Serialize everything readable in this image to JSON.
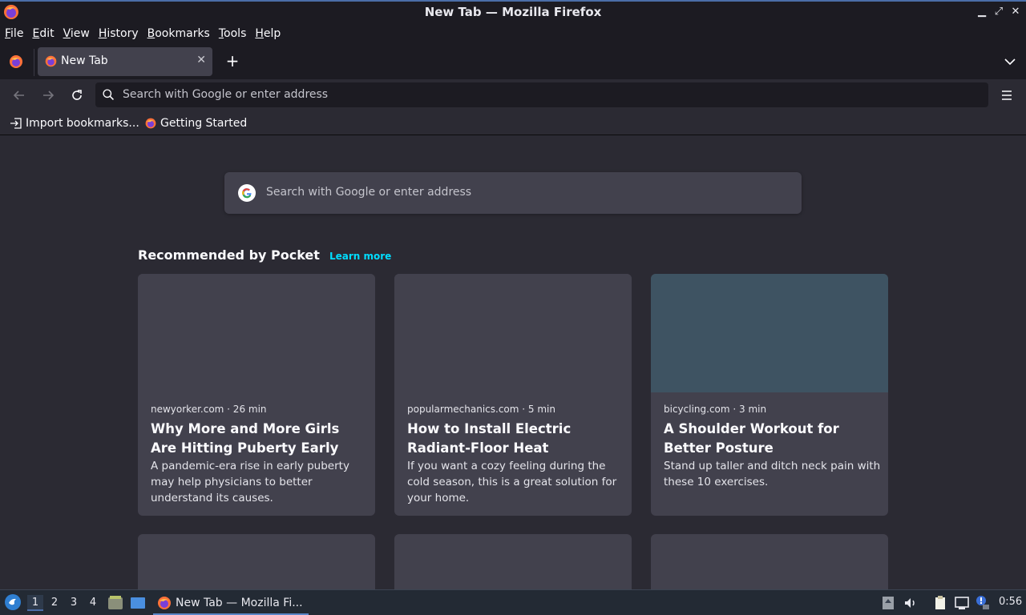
{
  "window": {
    "title": "New Tab — Mozilla Firefox",
    "minimize": "▁",
    "maximize": "⤢",
    "close": "✕"
  },
  "menubar": {
    "items": [
      "File",
      "Edit",
      "View",
      "History",
      "Bookmarks",
      "Tools",
      "Help"
    ]
  },
  "tabs": {
    "active_title": "New Tab",
    "close_glyph": "✕",
    "new_tab_glyph": "+"
  },
  "navbar": {
    "url_placeholder": "Search with Google or enter address"
  },
  "bookmarks": {
    "items": [
      {
        "label": "Import bookmarks...",
        "icon": "import-icon"
      },
      {
        "label": "Getting Started",
        "icon": "firefox-icon"
      }
    ]
  },
  "newtab": {
    "search_placeholder": "Search with Google or enter address",
    "pocket_title": "Recommended by Pocket",
    "learn_more": "Learn more",
    "cards": [
      {
        "meta": "newyorker.com · 26 min",
        "headline": "Why More and More Girls Are Hitting Puberty Early",
        "excerpt": "A pandemic-era rise in early puberty may help physicians to better understand its causes.",
        "thumb_color": "#42414d"
      },
      {
        "meta": "popularmechanics.com · 5 min",
        "headline": "How to Install Electric Radiant-Floor Heat",
        "excerpt": "If you want a cozy feeling during the cold season, this is a great solution for your home.",
        "thumb_color": "#42414d"
      },
      {
        "meta": "bicycling.com · 3 min",
        "headline": "A Shoulder Workout for Better Posture",
        "excerpt": "Stand up taller and ditch neck pain with these 10 exercises.",
        "thumb_color": "#3e5362"
      }
    ]
  },
  "taskbar": {
    "workspaces": [
      "1",
      "2",
      "3",
      "4"
    ],
    "task_label": "New Tab — Mozilla Fi...",
    "clock": "0:56"
  },
  "colors": {
    "accent": "#00ddff",
    "chrome_bg": "#1c1b22",
    "content_bg": "#2b2a33",
    "card_bg": "#42414d"
  }
}
